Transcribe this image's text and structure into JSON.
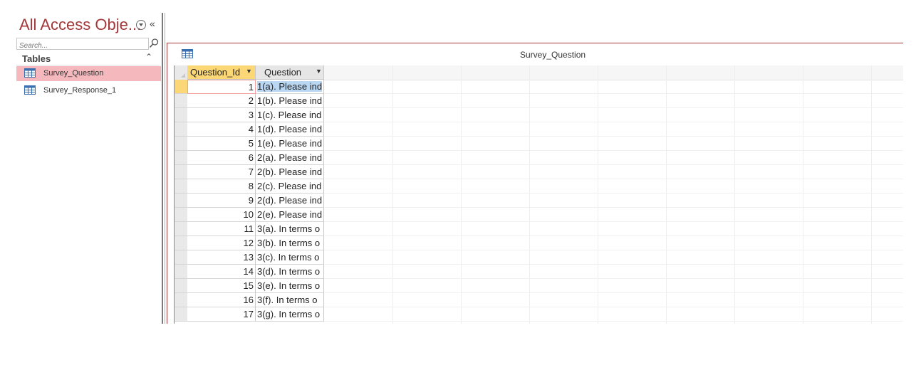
{
  "nav": {
    "title": "All Access Obje...",
    "search_placeholder": "Search...",
    "group_label": "Tables",
    "items": [
      {
        "label": "Survey_Question",
        "selected": true
      },
      {
        "label": "Survey_Response_1",
        "selected": false
      }
    ],
    "icons": {
      "menu": "chevron-down-circle-icon",
      "collapse": "double-chevron-left-icon",
      "search": "magnifier-icon",
      "group_toggle": "double-chevron-up-icon",
      "table": "table-icon"
    }
  },
  "document": {
    "title": "Survey_Question",
    "columns": [
      {
        "label": "Question_Id",
        "active": true
      },
      {
        "label": "Question",
        "active": false
      }
    ],
    "rows": [
      {
        "id": "1",
        "question": "1(a). Please ind"
      },
      {
        "id": "2",
        "question": "1(b). Please ind"
      },
      {
        "id": "3",
        "question": "1(c). Please ind"
      },
      {
        "id": "4",
        "question": "1(d). Please ind"
      },
      {
        "id": "5",
        "question": "1(e). Please ind"
      },
      {
        "id": "6",
        "question": "2(a). Please ind"
      },
      {
        "id": "7",
        "question": "2(b). Please ind"
      },
      {
        "id": "8",
        "question": "2(c). Please ind"
      },
      {
        "id": "9",
        "question": "2(d). Please ind"
      },
      {
        "id": "10",
        "question": "2(e). Please ind"
      },
      {
        "id": "11",
        "question": "3(a). In terms o"
      },
      {
        "id": "12",
        "question": "3(b). In terms o"
      },
      {
        "id": "13",
        "question": "3(c). In terms o"
      },
      {
        "id": "14",
        "question": "3(d). In terms o"
      },
      {
        "id": "15",
        "question": "3(e). In terms o"
      },
      {
        "id": "16",
        "question": "3(f). In terms o"
      },
      {
        "id": "17",
        "question": "3(g). In terms o"
      }
    ]
  },
  "colors": {
    "accent": "#a4373a",
    "selected_nav": "#f4b8bd",
    "active_header": "#fbd775",
    "selected_cell": "#b9d7f3"
  }
}
